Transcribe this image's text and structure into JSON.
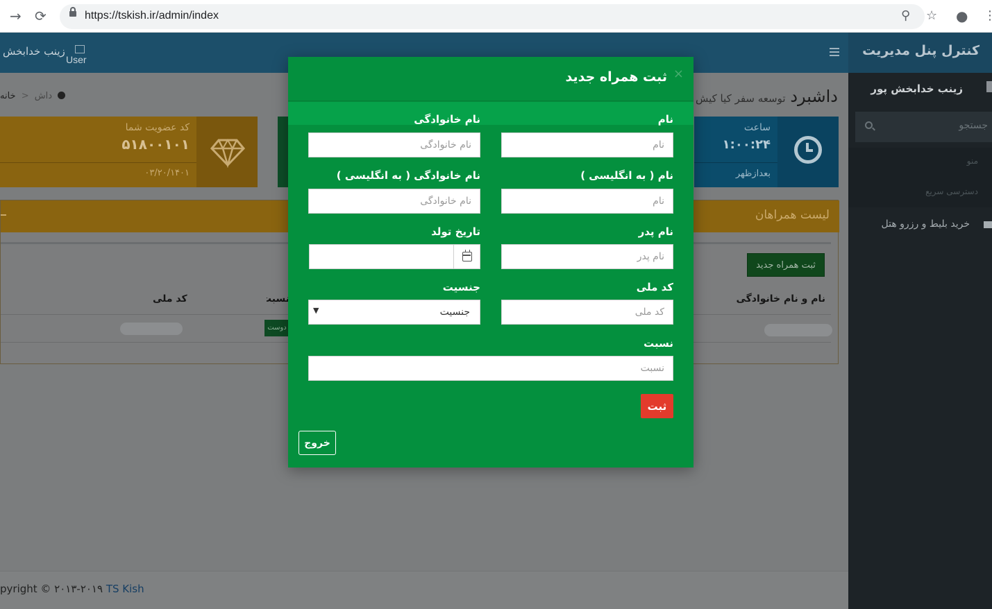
{
  "browser": {
    "url": "https://tskish.ir/admin/index",
    "back_glyph": "→",
    "reload_glyph": "⟳",
    "zoom_glyph": "⚲",
    "star_glyph": "☆",
    "account_glyph": "●",
    "menu_glyph": "⋮"
  },
  "header": {
    "user_name": "زینب خدابخش",
    "user_image_alt": "User"
  },
  "sidebar": {
    "logo": "کنترل پنل مدیریت",
    "user_name": "زینب خدابخش پور",
    "search_placeholder": "جستجو",
    "menu_label": "منو",
    "quick_access": "دسترسی سریع",
    "items": [
      {
        "label": "خرید بلیط و رزرو هتل"
      }
    ]
  },
  "content": {
    "page_title": "داشبرد",
    "page_subtitle": "توسعه سفر کیا کیش",
    "breadcrumb": {
      "home": "خانه",
      "current": "داش"
    },
    "tiles": {
      "membership": {
        "label": "کد عضویت شما",
        "value": "۵۱۸۰۰۱۰۱",
        "footer": "۰۳/۲۰/۱۴۰۱"
      },
      "time": {
        "label": "ساعت",
        "value": "۱:۰۰:۲۴",
        "footer": "بعدازظهر"
      }
    },
    "companions": {
      "title": "لیست همراهان",
      "add_button": "ثبت همراه جدید",
      "columns": [
        "نام و نام خانوادگی",
        "نسبت",
        "کد ملی"
      ],
      "relation_badge": "دوست"
    },
    "footer": {
      "copyright": "pyright © ۲۰۱۳-۲۰۱۹ ",
      "brand": "TS Kish"
    }
  },
  "modal": {
    "title": "ثبت همراه جدید",
    "close": "×",
    "fields": {
      "first_name": {
        "label": "نام",
        "placeholder": "نام"
      },
      "last_name": {
        "label": "نام خانوادگی",
        "placeholder": "نام خانوادگی"
      },
      "first_name_en": {
        "label": "نام ( به انگلیسی )",
        "placeholder": "نام"
      },
      "last_name_en": {
        "label": "نام خانوادگی ( به انگلیسی )",
        "placeholder": "نام خانوادگی"
      },
      "father_name": {
        "label": "نام پدر",
        "placeholder": "نام پدر"
      },
      "birth_date": {
        "label": "تاریخ تولد",
        "placeholder": ""
      },
      "national_code": {
        "label": "کد ملی",
        "placeholder": "کد ملی"
      },
      "gender": {
        "label": "جنسیت",
        "value": "جنسیت"
      },
      "relation": {
        "label": "نسبت",
        "placeholder": "نسبت"
      }
    },
    "submit": "ثبت",
    "exit": "خروج"
  }
}
